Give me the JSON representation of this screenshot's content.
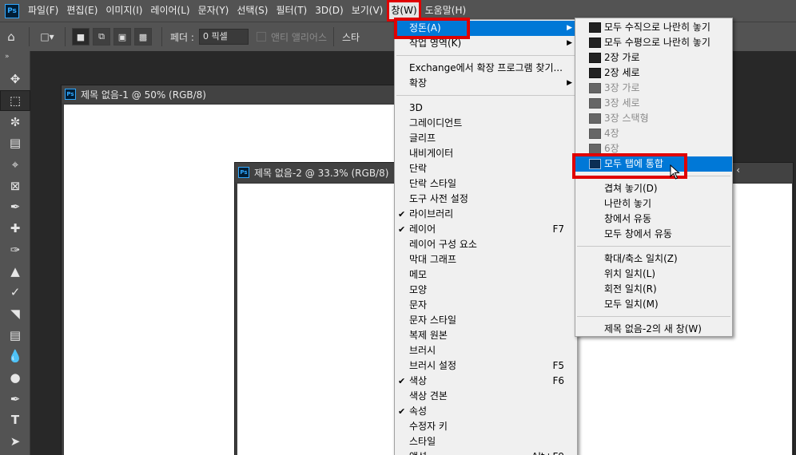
{
  "menubar": {
    "logo": "Ps",
    "items": [
      "파일(F)",
      "편집(E)",
      "이미지(I)",
      "레이어(L)",
      "문자(Y)",
      "선택(S)",
      "필터(T)",
      "3D(D)",
      "보기(V)",
      "창(W)",
      "도움말(H)"
    ],
    "active_index": 9
  },
  "options_bar": {
    "feather_label": "페더 :",
    "feather_value": "0 픽셀",
    "antialias_label": "앤티 앨리어스",
    "style_label": "스타"
  },
  "documents": [
    {
      "title": "제목 없음-1 @ 50% (RGB/8)",
      "icon": "Ps"
    },
    {
      "title": "제목 없음-2 @ 33.3% (RGB/8)",
      "icon": "Ps"
    }
  ],
  "window_menu": {
    "items": [
      {
        "label": "정돈(A)",
        "submenu": true,
        "highlighted": true
      },
      {
        "label": "작업 영역(K)",
        "submenu": true
      },
      {
        "sep": true
      },
      {
        "label": "Exchange에서 확장 프로그램 찾기..."
      },
      {
        "label": "확장",
        "submenu": true
      },
      {
        "sep": true
      },
      {
        "label": "3D"
      },
      {
        "label": "그레이디언트"
      },
      {
        "label": "글리프"
      },
      {
        "label": "내비게이터"
      },
      {
        "label": "단락"
      },
      {
        "label": "단락 스타일"
      },
      {
        "label": "도구 사전 설정"
      },
      {
        "label": "라이브러리",
        "checked": true
      },
      {
        "label": "레이어",
        "checked": true,
        "shortcut": "F7"
      },
      {
        "label": "레이어 구성 요소"
      },
      {
        "label": "막대 그래프"
      },
      {
        "label": "메모"
      },
      {
        "label": "모양"
      },
      {
        "label": "문자"
      },
      {
        "label": "문자 스타일"
      },
      {
        "label": "복제 원본"
      },
      {
        "label": "브러시"
      },
      {
        "label": "브러시 설정",
        "shortcut": "F5"
      },
      {
        "label": "색상",
        "checked": true,
        "shortcut": "F6"
      },
      {
        "label": "색상 견본"
      },
      {
        "label": "속성",
        "checked": true
      },
      {
        "label": "수정자 키"
      },
      {
        "label": "스타일"
      },
      {
        "label": "액션",
        "shortcut": "Alt+F9"
      }
    ]
  },
  "arrange_submenu": {
    "items": [
      {
        "label": "모두 수직으로 나란히 놓기",
        "layout_icon": "vertical-tile-icon"
      },
      {
        "label": "모두 수평으로 나란히 놓기",
        "layout_icon": "horizontal-tile-icon"
      },
      {
        "label": "2장 가로",
        "layout_icon": "two-up-horizontal-icon"
      },
      {
        "label": "2장 세로",
        "layout_icon": "two-up-vertical-icon"
      },
      {
        "label": "3장 가로",
        "layout_icon": "three-up-horizontal-icon",
        "disabled": true
      },
      {
        "label": "3장 세로",
        "layout_icon": "three-up-vertical-icon",
        "disabled": true
      },
      {
        "label": "3장 스택형",
        "layout_icon": "three-up-stacked-icon",
        "disabled": true
      },
      {
        "label": "4장",
        "layout_icon": "four-up-icon",
        "disabled": true
      },
      {
        "label": "6장",
        "layout_icon": "six-up-icon",
        "disabled": true
      },
      {
        "label": "모두 탭에 통합",
        "layout_icon": "consolidate-tabs-icon",
        "highlighted": true
      },
      {
        "sep": true
      },
      {
        "label": "겹쳐 놓기(D)"
      },
      {
        "label": "나란히 놓기"
      },
      {
        "label": "창에서 유동"
      },
      {
        "label": "모두 창에서 유동"
      },
      {
        "sep": true
      },
      {
        "label": "확대/축소 일치(Z)"
      },
      {
        "label": "위치 일치(L)"
      },
      {
        "label": "회전 일치(R)"
      },
      {
        "label": "모두 일치(M)"
      },
      {
        "sep": true
      },
      {
        "label": "제목 없음-2의 새 창(W)"
      }
    ]
  },
  "colors": {
    "highlight": "#0078d7",
    "annotation_red": "#e00000",
    "ps_blue": "#31a8ff"
  }
}
